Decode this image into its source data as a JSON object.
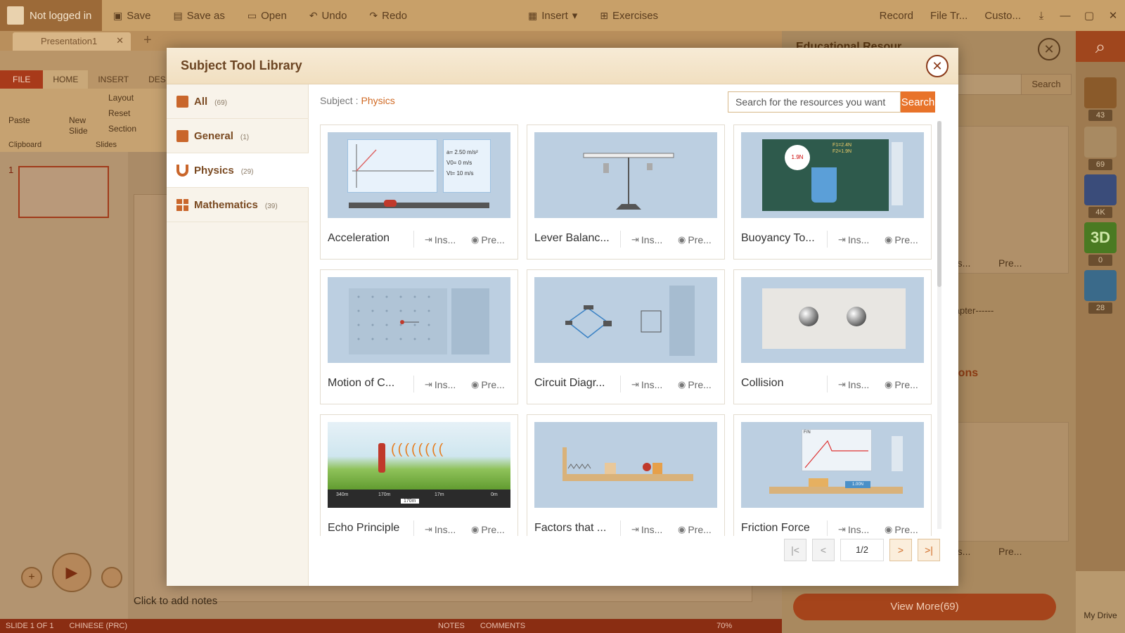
{
  "app": {
    "login_status": "Not logged in",
    "toolbar": {
      "save": "Save",
      "save_as": "Save as",
      "open": "Open",
      "undo": "Undo",
      "redo": "Redo",
      "insert": "Insert",
      "exercises": "Exercises",
      "record": "Record",
      "file_transfer": "File Tr...",
      "customize": "Custo..."
    },
    "doc_tab": "Presentation1",
    "ribbon_tabs": [
      "FILE",
      "HOME",
      "INSERT",
      "DESIG"
    ],
    "ribbon": {
      "paste": "Paste",
      "new_slide": "New Slide",
      "layout": "Layout",
      "reset": "Reset",
      "section": "Section",
      "clipboard_group": "Clipboard",
      "slides_group": "Slides"
    },
    "slide_number": "1",
    "notes_placeholder": "Click to add notes",
    "statusbar": {
      "slide": "SLIDE 1 OF 1",
      "language": "CHINESE (PRC)",
      "notes": "NOTES",
      "comments": "COMMENTS",
      "zoom": "70%"
    },
    "side_panel": {
      "title": "Educational Resour...",
      "search_button": "Search",
      "chapter_text": "chapter------",
      "section_text": "ations",
      "card_insert": "Ins...",
      "card_preview": "Pre...",
      "view_more": "View More(69)"
    },
    "rail_counts": [
      "43",
      "69",
      "4K",
      "0",
      "28"
    ],
    "my_drive": "My Drive"
  },
  "modal": {
    "title": "Subject Tool Library",
    "categories": [
      {
        "name": "All",
        "count": "(69)"
      },
      {
        "name": "General",
        "count": "(1)"
      },
      {
        "name": "Physics",
        "count": "(29)"
      },
      {
        "name": "Mathematics",
        "count": "(39)"
      }
    ],
    "subject_label": "Subject",
    "subject_value": "Physics",
    "search_placeholder": "Search for the resources you want",
    "search_button": "Search",
    "insert_label": "Ins...",
    "preview_label": "Pre...",
    "cards": [
      {
        "title": "Acceleration"
      },
      {
        "title": "Lever Balanc..."
      },
      {
        "title": "Buoyancy To..."
      },
      {
        "title": "Motion of C..."
      },
      {
        "title": "Circuit Diagr..."
      },
      {
        "title": "Collision"
      },
      {
        "title": "Echo Principle"
      },
      {
        "title": "Factors that ..."
      },
      {
        "title": "Friction Force"
      }
    ],
    "illustrations": {
      "acc_vel": "a= 2.50 m/s²",
      "acc_v0": "V0= 0 m/s",
      "acc_vt": "Vt= 10 m/s",
      "buoy_reading": "1.9N",
      "buoy_f1": "F1=2.4N",
      "buoy_f2": "F2=1.9N",
      "echo_marks": [
        "340m",
        "170m",
        "17m",
        "0m"
      ],
      "echo_value": "170m",
      "friction_reading": "1.00N",
      "friction_axis": "F/N"
    },
    "pagination": {
      "current": "1/2"
    }
  }
}
